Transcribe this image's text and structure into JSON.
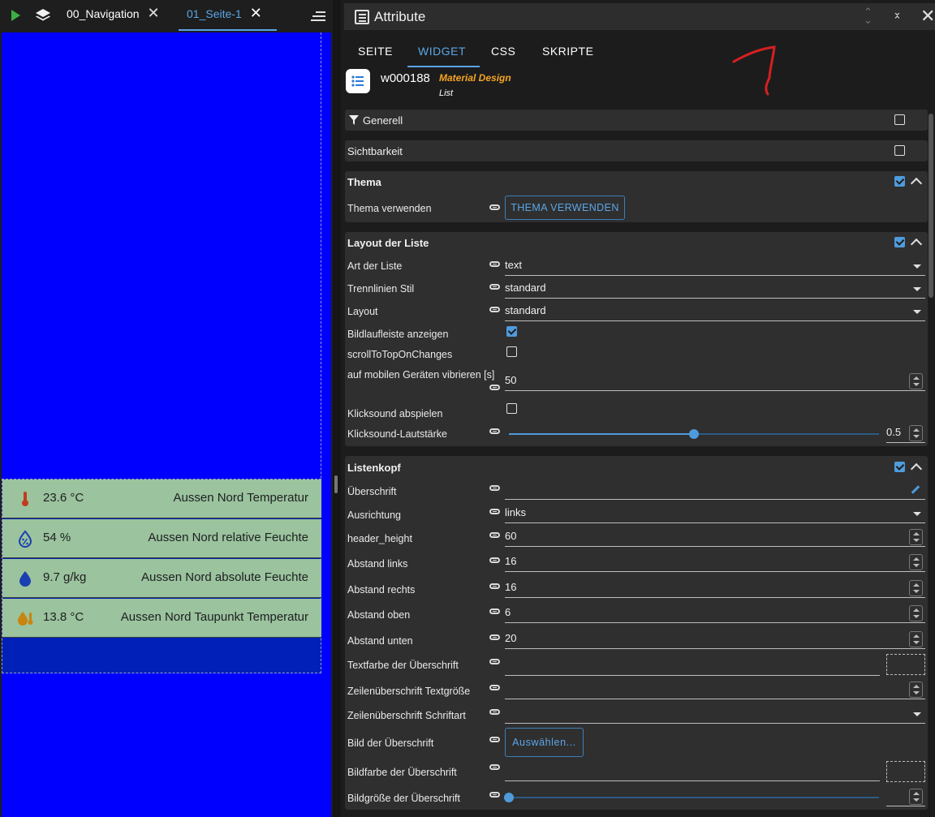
{
  "editor": {
    "tabs": [
      {
        "label": "00_Navigation",
        "close": "✕"
      },
      {
        "label": "01_Seite-1",
        "close": "✕"
      }
    ],
    "list_items": [
      {
        "value": "23.6 °C",
        "label": "Aussen Nord Temperatur",
        "icon": "thermometer-icon"
      },
      {
        "value": "54 %",
        "label": "Aussen Nord relative Feuchte",
        "icon": "humidity-percent-icon"
      },
      {
        "value": "9.7 g/kg",
        "label": "Aussen Nord absolute Feuchte",
        "icon": "water-drop-icon"
      },
      {
        "value": "13.8 °C",
        "label": "Aussen Nord Taupunkt Temperatur",
        "icon": "dewpoint-icon"
      }
    ],
    "colors": {
      "canvas": "#0000fe",
      "list_bg": "#0020b8",
      "item_bg": "#9ac39e"
    }
  },
  "panel": {
    "title": "Attribute",
    "tabs": [
      "SEITE",
      "WIDGET",
      "CSS",
      "SKRIPTE"
    ],
    "active_tab": "WIDGET",
    "widget": {
      "id": "w000188",
      "set": "Material Design",
      "type": "List"
    },
    "groups": {
      "generell": {
        "title": "Generell"
      },
      "sichtbarkeit": {
        "title": "Sichtbarkeit"
      },
      "thema": {
        "title": "Thema",
        "thema_verwenden_label": "Thema verwenden",
        "thema_verwenden_button": "THEMA VERWENDEN"
      },
      "layout": {
        "title": "Layout der Liste",
        "art_label": "Art der Liste",
        "art_value": "text",
        "trenn_label": "Trennlinien Stil",
        "trenn_value": "standard",
        "layout_label": "Layout",
        "layout_value": "standard",
        "bildlauf_label": "Bildlaufleiste anzeigen",
        "bildlauf_checked": true,
        "scrolltop_label": "scrollToTopOnChanges",
        "scrolltop_checked": false,
        "vibrieren_label": "auf mobilen Geräten vibrieren [s]",
        "vibrieren_value": "50",
        "klick_label": "Klicksound abspielen",
        "klick_checked": false,
        "lautstaerke_label": "Klicksound-Lautstärke",
        "lautstaerke_value": "0.5"
      },
      "listenkopf": {
        "title": "Listenkopf",
        "ueberschrift_label": "Überschrift",
        "ueberschrift_value": "",
        "ausrichtung_label": "Ausrichtung",
        "ausrichtung_value": "links",
        "header_height_label": "header_height",
        "header_height_value": "60",
        "abstand_links_label": "Abstand links",
        "abstand_links_value": "16",
        "abstand_rechts_label": "Abstand rechts",
        "abstand_rechts_value": "16",
        "abstand_oben_label": "Abstand oben",
        "abstand_oben_value": "6",
        "abstand_unten_label": "Abstand unten",
        "abstand_unten_value": "20",
        "textfarbe_label": "Textfarbe der Überschrift",
        "textgroesse_label": "Zeilenüberschrift Textgröße",
        "schriftart_label": "Zeilenüberschrift Schriftart",
        "bild_label": "Bild der Überschrift",
        "bild_button": "Auswählen...",
        "bildfarbe_label": "Bildfarbe der Überschrift",
        "bildgroesse_label": "Bildgröße der Überschrift"
      }
    },
    "colors": {
      "accent": "#4f9bdc",
      "set_color": "#f5a623"
    }
  }
}
